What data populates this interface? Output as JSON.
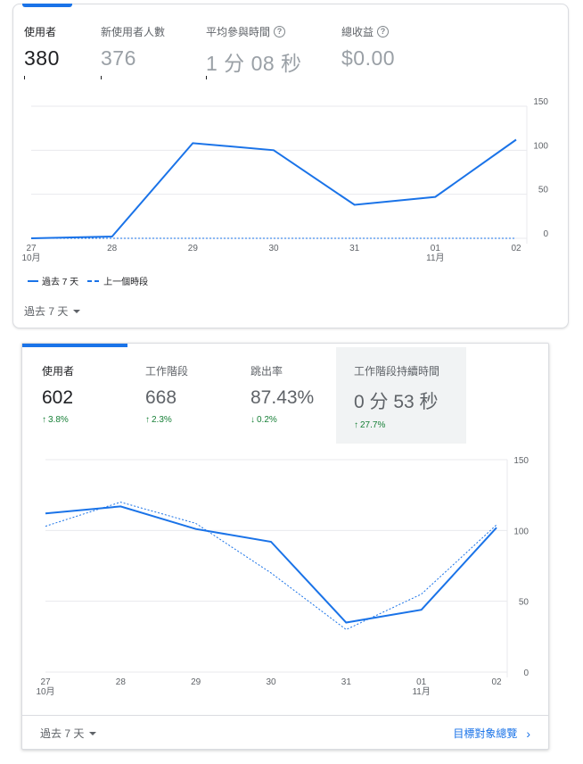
{
  "card1": {
    "metrics": [
      {
        "label": "使用者",
        "value": "380",
        "active": true,
        "help": false
      },
      {
        "label": "新使用者人數",
        "value": "376",
        "active": false,
        "help": false
      },
      {
        "label": "平均參與時間",
        "value": "1 分 08 秒",
        "active": false,
        "help": true
      },
      {
        "label": "總收益",
        "value": "$0.00",
        "active": false,
        "help": true
      }
    ],
    "legend": {
      "current": "過去 7 天",
      "previous": "上一個時段"
    },
    "period_selector": "過去 7 天",
    "accent_color": "#1a73e8"
  },
  "card2": {
    "metrics": [
      {
        "label": "使用者",
        "value": "602",
        "change": "3.8%",
        "direction": "up"
      },
      {
        "label": "工作階段",
        "value": "668",
        "change": "2.3%",
        "direction": "up"
      },
      {
        "label": "跳出率",
        "value": "87.43%",
        "change": "0.2%",
        "direction": "down"
      },
      {
        "label": "工作階段持續時間",
        "value": "0 分 53 秒",
        "change": "27.7%",
        "direction": "up"
      }
    ],
    "period_selector": "過去 7 天",
    "footer_link": "目標對象總覽",
    "change_color": "#188038"
  },
  "chart_data": [
    {
      "type": "line",
      "x": [
        "27\n10月",
        "28",
        "29",
        "30",
        "31",
        "01\n11月",
        "02"
      ],
      "x_ticks": [
        "27",
        "28",
        "29",
        "30",
        "31",
        "01",
        "02"
      ],
      "x_subticks": {
        "27": "10月",
        "01": "11月"
      },
      "y_ticks": [
        0,
        50,
        100,
        150
      ],
      "ylim": [
        0,
        150
      ],
      "y_axis_side": "right",
      "series": [
        {
          "name": "過去 7 天",
          "style": "solid",
          "values": [
            0,
            2,
            108,
            100,
            38,
            47,
            112
          ]
        },
        {
          "name": "上一個時段",
          "style": "dashed",
          "values": [
            0,
            0,
            0,
            0,
            0,
            0,
            0
          ]
        }
      ],
      "legend_position": "bottom-left"
    },
    {
      "type": "line",
      "x_ticks": [
        "27",
        "28",
        "29",
        "30",
        "31",
        "01",
        "02"
      ],
      "x_subticks": {
        "27": "10月",
        "01": "11月"
      },
      "y_ticks": [
        0,
        50,
        100,
        150
      ],
      "ylim": [
        0,
        150
      ],
      "y_axis_side": "right",
      "series": [
        {
          "style": "solid",
          "values": [
            112,
            117,
            101,
            92,
            35,
            44,
            102
          ]
        },
        {
          "style": "dashed",
          "values": [
            103,
            120,
            105,
            70,
            30,
            55,
            104
          ]
        }
      ]
    }
  ]
}
